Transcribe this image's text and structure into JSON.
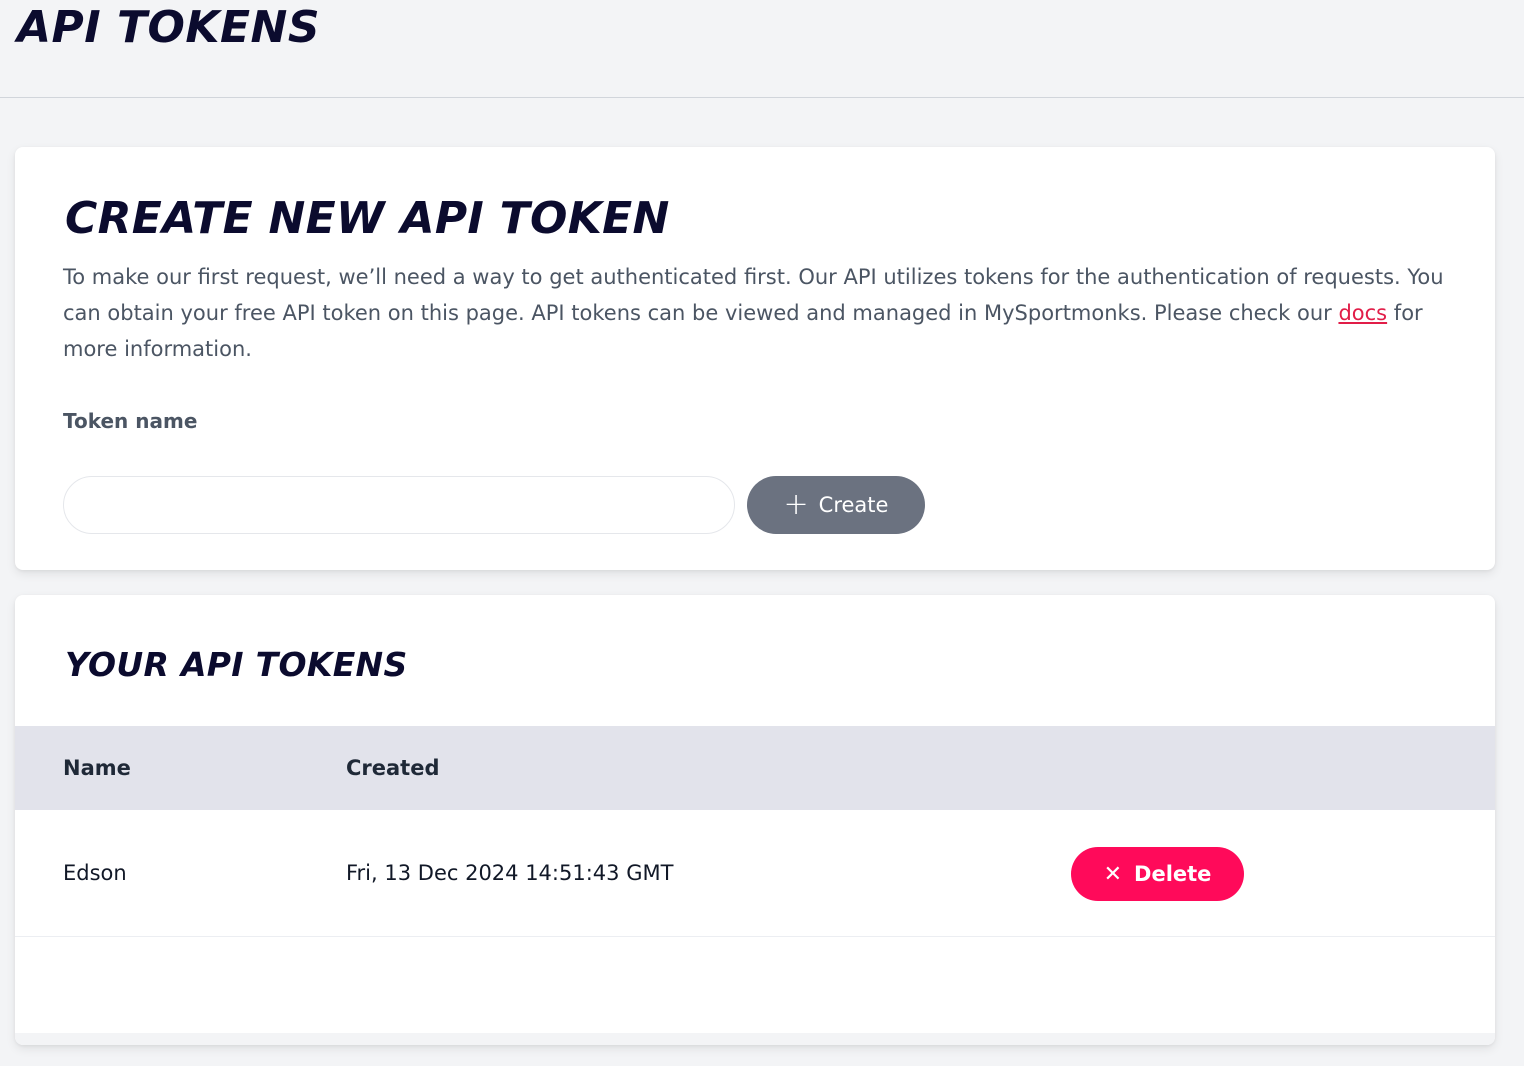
{
  "header": {
    "title": "API TOKENS"
  },
  "create_section": {
    "title": "CREATE NEW API TOKEN",
    "description_part1": "To make our first request, we’ll need a way to get authenticated first. Our API utilizes tokens for the authentication of requests. You can obtain your free API token on this page. API tokens can be viewed and managed in MySportmonks. Please check our ",
    "docs_link": "docs",
    "description_part2": " for more information.",
    "field_label": "Token name",
    "input_value": "",
    "input_placeholder": "",
    "create_button_label": "Create",
    "create_icon": "plus-icon"
  },
  "tokens_section": {
    "title": "YOUR API TOKENS",
    "columns": [
      "Name",
      "Created"
    ],
    "rows": [
      {
        "name": "Edson",
        "created": "Fri, 13 Dec 2024 14:51:43 GMT",
        "delete_label": "Delete",
        "delete_icon": "close-icon"
      }
    ]
  },
  "colors": {
    "title": "#0b0b2e",
    "link": "#e11d48",
    "create_button": "#6b7280",
    "delete_button": "#ff0a5a",
    "table_header": "#e2e3eb"
  }
}
